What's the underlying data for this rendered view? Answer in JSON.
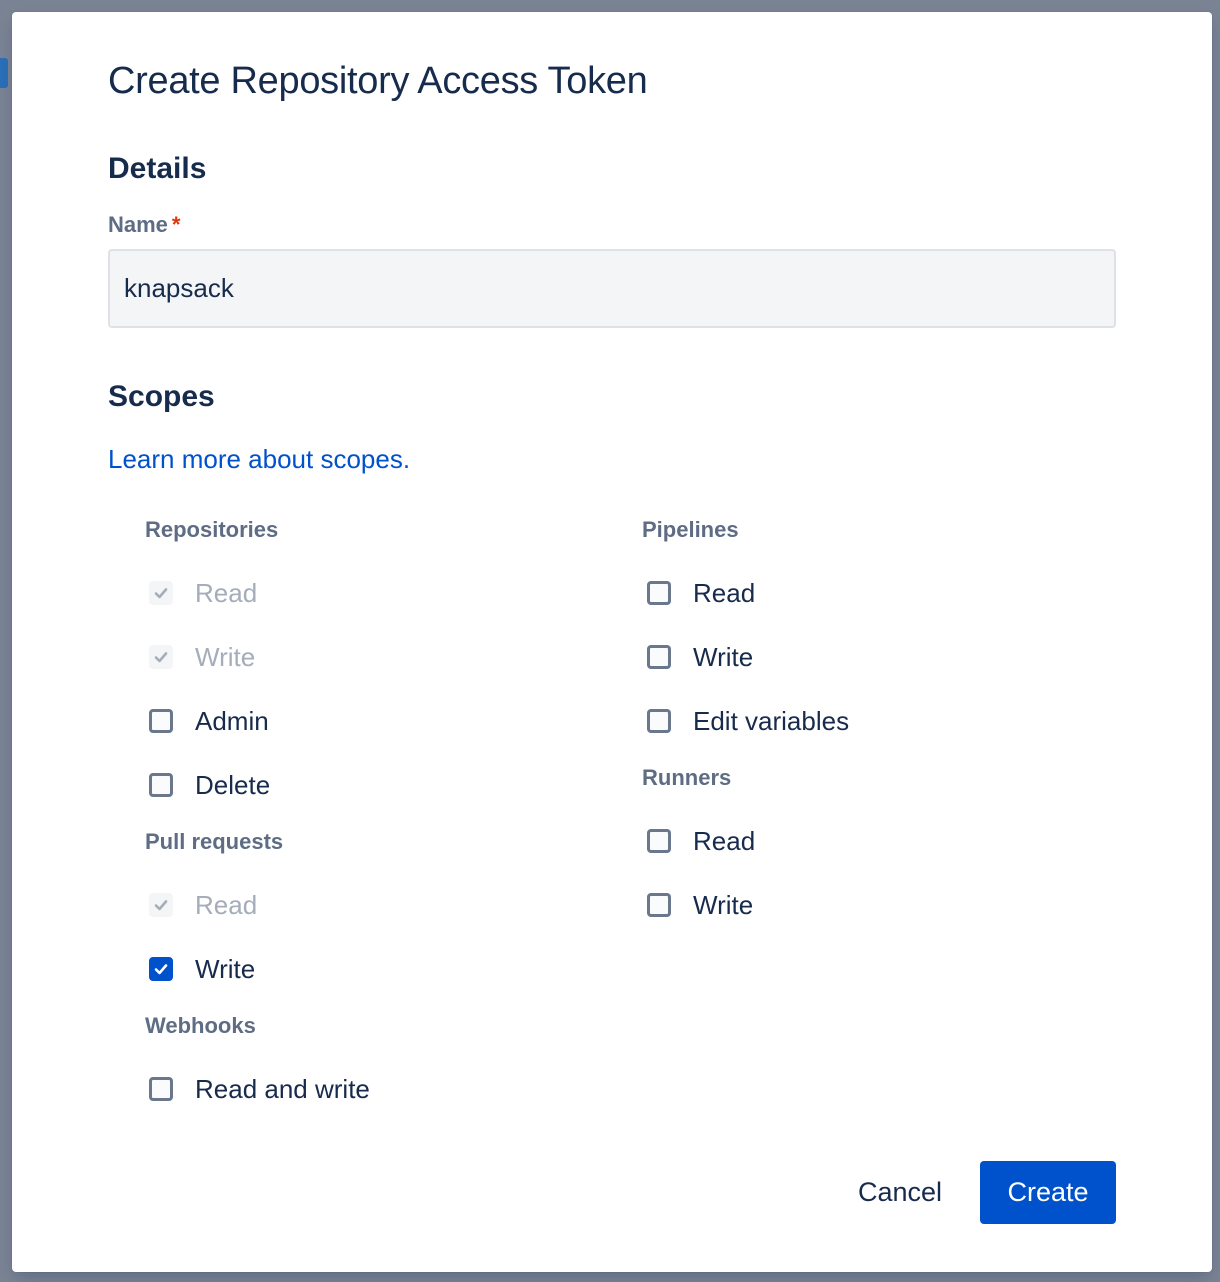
{
  "dialog": {
    "title": "Create Repository Access Token",
    "details_heading": "Details",
    "name_label": "Name",
    "name_required_marker": "*",
    "name_value": "knapsack",
    "scopes_heading": "Scopes",
    "learn_more_link": "Learn more about scopes.",
    "cancel_label": "Cancel",
    "create_label": "Create"
  },
  "scopes": {
    "repositories": {
      "label": "Repositories",
      "items": [
        {
          "label": "Read",
          "checked": true,
          "disabled": true
        },
        {
          "label": "Write",
          "checked": true,
          "disabled": true
        },
        {
          "label": "Admin",
          "checked": false,
          "disabled": false
        },
        {
          "label": "Delete",
          "checked": false,
          "disabled": false
        }
      ]
    },
    "pull_requests": {
      "label": "Pull requests",
      "items": [
        {
          "label": "Read",
          "checked": true,
          "disabled": true
        },
        {
          "label": "Write",
          "checked": true,
          "disabled": false
        }
      ]
    },
    "webhooks": {
      "label": "Webhooks",
      "items": [
        {
          "label": "Read and write",
          "checked": false,
          "disabled": false
        }
      ]
    },
    "pipelines": {
      "label": "Pipelines",
      "items": [
        {
          "label": "Read",
          "checked": false,
          "disabled": false
        },
        {
          "label": "Write",
          "checked": false,
          "disabled": false
        },
        {
          "label": "Edit variables",
          "checked": false,
          "disabled": false
        }
      ]
    },
    "runners": {
      "label": "Runners",
      "items": [
        {
          "label": "Read",
          "checked": false,
          "disabled": false
        },
        {
          "label": "Write",
          "checked": false,
          "disabled": false
        }
      ]
    }
  },
  "colors": {
    "primary": "#0052cc",
    "text": "#172b4d",
    "subtle_text": "#5e6c84",
    "disabled_text": "#a5adba",
    "required": "#de350b",
    "overlay": "#7a8394"
  }
}
